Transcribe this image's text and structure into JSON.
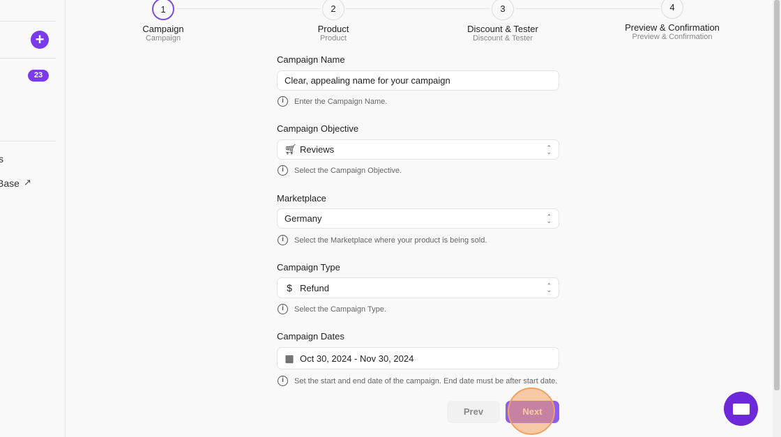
{
  "sidebar": {
    "badge": "23",
    "item_1": "s",
    "item_2": "Base"
  },
  "steps": [
    {
      "num": "1",
      "label": "Campaign",
      "sub": "Campaign"
    },
    {
      "num": "2",
      "label": "Product",
      "sub": "Product"
    },
    {
      "num": "3",
      "label": "Discount & Tester",
      "sub": "Discount & Tester"
    },
    {
      "num": "4",
      "label": "Preview & Confirmation",
      "sub": "Preview & Confirmation"
    }
  ],
  "form": {
    "name": {
      "label": "Campaign Name",
      "value": "Clear, appealing name for your campaign",
      "help": "Enter the Campaign Name."
    },
    "objective": {
      "label": "Campaign Objective",
      "value": "Reviews",
      "help": "Select the Campaign Objective."
    },
    "marketplace": {
      "label": "Marketplace",
      "value": "Germany",
      "help": "Select the Marketplace where your product is being sold."
    },
    "type": {
      "label": "Campaign Type",
      "value": "Refund",
      "help": "Select the Campaign Type."
    },
    "dates": {
      "label": "Campaign Dates",
      "value": "Oct 30, 2024 - Nov 30, 2024",
      "help": "Set the start and end date of the campaign. End date must be after start date."
    }
  },
  "buttons": {
    "prev": "Prev",
    "next": "Next"
  },
  "colors": {
    "accent": "#7c3aed",
    "highlight": "#f5a25d"
  }
}
